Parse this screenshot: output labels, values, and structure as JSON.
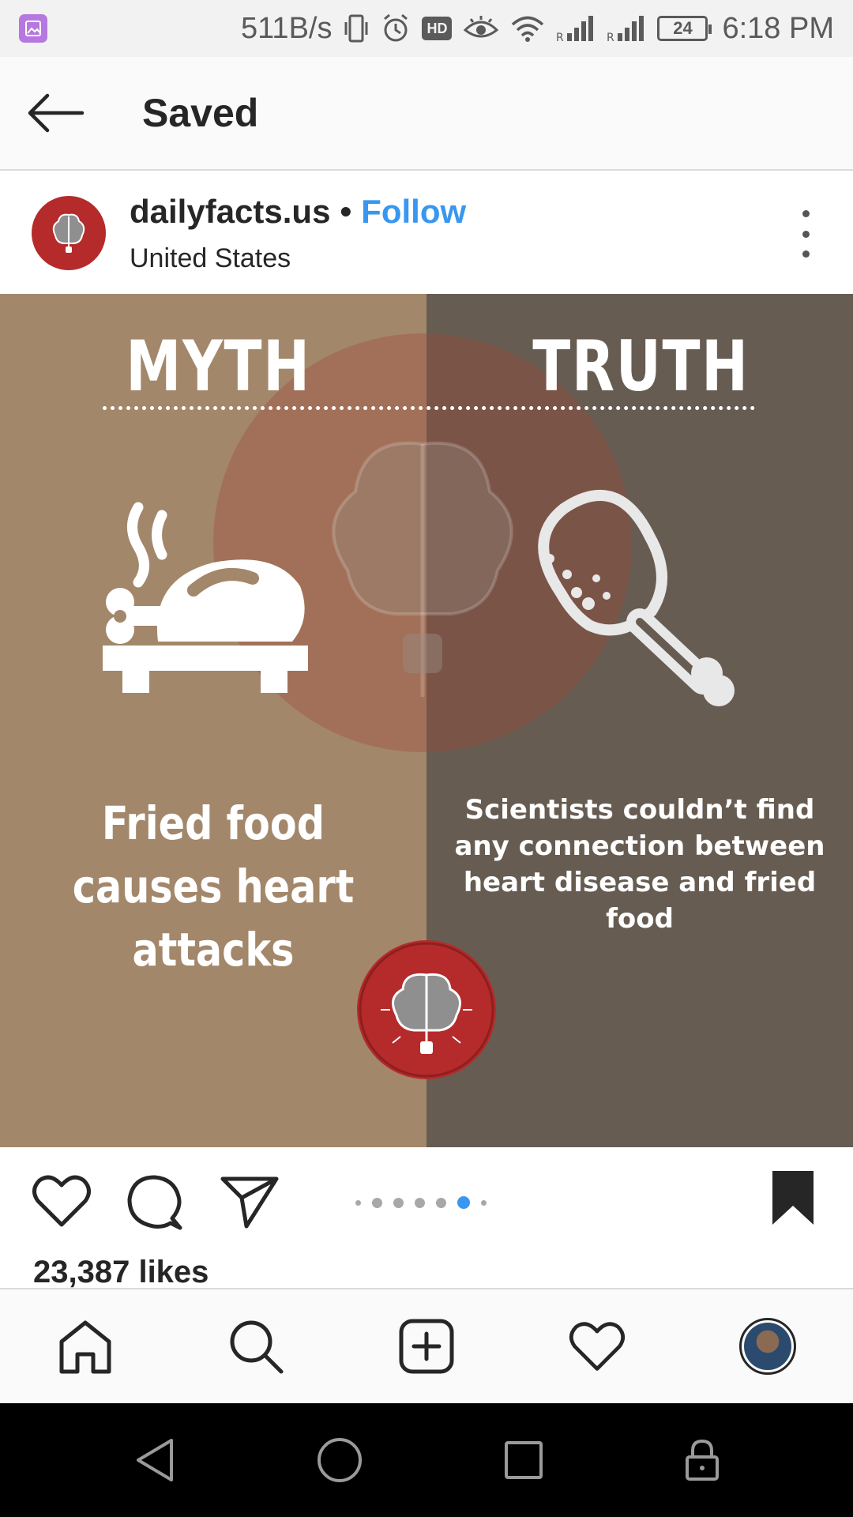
{
  "status_bar": {
    "speed": "511B/s",
    "hd": "HD",
    "battery": "24",
    "time": "6:18 PM"
  },
  "app_bar": {
    "title": "Saved"
  },
  "post": {
    "username": "dailyfacts.us",
    "separator": "•",
    "follow_label": "Follow",
    "location": "United States",
    "image": {
      "myth_heading": "MYTH",
      "truth_heading": "TRUTH",
      "myth_line1": "Fried food",
      "myth_line2": "causes heart attacks",
      "truth_text": "Scientists couldn’t find any connection between heart disease and fried food",
      "colors": {
        "left_bg": "#a3876a",
        "right_bg": "#675c52",
        "badge": "#b52a2a"
      }
    },
    "carousel": {
      "total": 7,
      "active_index": 5
    },
    "likes": "23,387 likes"
  },
  "icons": {
    "back": "arrow-left-icon",
    "like": "heart-icon",
    "comment": "comment-icon",
    "share": "paper-plane-icon",
    "save": "bookmark-filled-icon",
    "more": "vertical-dots-icon"
  },
  "bottom_nav": [
    "home-icon",
    "search-icon",
    "add-post-icon",
    "activity-heart-icon",
    "profile-avatar"
  ],
  "system_nav": [
    "back-triangle-icon",
    "home-circle-icon",
    "recents-square-icon",
    "lock-icon"
  ],
  "accent_color": "#3897f0"
}
